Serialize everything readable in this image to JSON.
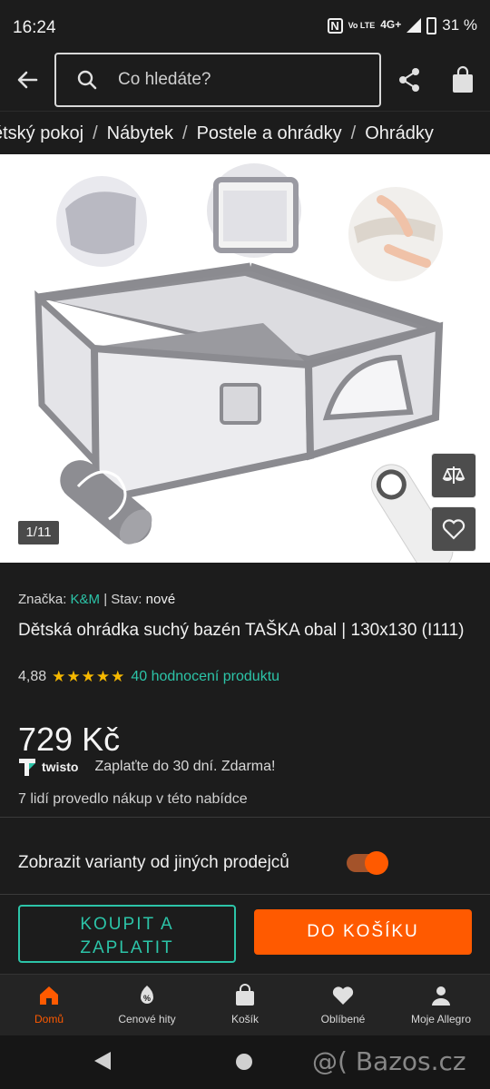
{
  "status_bar": {
    "time": "16:24",
    "volte": "Vo LTE",
    "network": "4G+",
    "battery": "31 %"
  },
  "search": {
    "placeholder": "Co hledáte?"
  },
  "breadcrumb": [
    "ětský pokoj",
    "Nábytek",
    "Postele a ohrádky",
    "Ohrádky"
  ],
  "gallery": {
    "counter": "1/11",
    "compare_icon": "compare-scale-icon",
    "favorite_icon": "heart-icon"
  },
  "product": {
    "brand_label": "Značka:",
    "brand": "K&M",
    "separator": "|",
    "condition_label": "Stav:",
    "condition": "nové",
    "title": "Dětská ohrádka suchý bazén TAŠKA obal | 130x130 (I111)",
    "rating": "4,88",
    "stars": "★★★★★",
    "rating_count": "40 hodnocení produktu",
    "price": "729 Kč",
    "twisto_brand": "twisto",
    "twisto_text": "Zaplaťte do 30 dní. Zdarma!",
    "bought_text": "7 lidí provedlo nákup v této nabídce"
  },
  "variants": {
    "label": "Zobrazit varianty od jiných prodejců",
    "enabled": true
  },
  "actions": {
    "buy_label_1": "KOUPIT A",
    "buy_label_2": "ZAPLATIT",
    "cart_label": "DO KOŠÍKU"
  },
  "bottom_nav": [
    {
      "label": "Domů",
      "icon": "home-icon",
      "active": true
    },
    {
      "label": "Cenové hity",
      "icon": "percent-tag-icon",
      "active": false
    },
    {
      "label": "Košík",
      "icon": "bag-icon",
      "active": false
    },
    {
      "label": "Oblíbené",
      "icon": "heart-icon",
      "active": false
    },
    {
      "label": "Moje Allegro",
      "icon": "user-icon",
      "active": false
    }
  ],
  "watermark": "@( Bazos.cz",
  "colors": {
    "accent": "#ff5a00",
    "teal": "#2cc4a8",
    "star": "#f6b800",
    "background": "#1c1c1c"
  }
}
